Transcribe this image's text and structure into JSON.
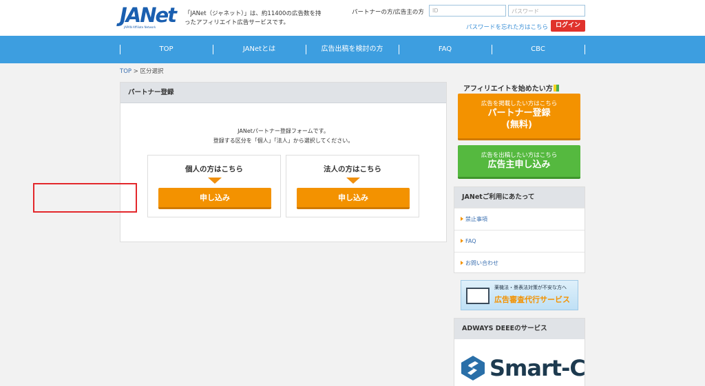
{
  "header": {
    "logo_text": "JANet",
    "logo_sub": "JAPAN Affiliate Network",
    "tagline": "「JANet（ジャネット）」は、約11400の広告数を持ったアフィリエイト広告サービスです。",
    "login_label": "パートナーの方/広告主の方",
    "id_placeholder": "ID",
    "password_placeholder": "パスワード",
    "forgot_password": "パスワードを忘れた方はこちら",
    "login_button": "ログイン"
  },
  "nav": {
    "items": [
      "TOP",
      "JANetとは",
      "広告出稿を検討の方",
      "FAQ",
      "CBC"
    ]
  },
  "breadcrumb": {
    "home": "TOP",
    "separator": ">",
    "current": "区分選択"
  },
  "main": {
    "panel_title": "パートナー登録",
    "intro_line1": "JANetパートナー登録フォームです。",
    "intro_line2": "登録する区分を「個人」「法人」から選択してください。",
    "individual": {
      "title": "個人の方はこちら",
      "button": "申し込み"
    },
    "corporate": {
      "title": "法人の方はこちら",
      "button": "申し込み"
    }
  },
  "sidebar": {
    "title": "アフィリエイトを始めたい方",
    "partner_cta": {
      "sub": "広告を掲載したい方はこちら",
      "main_line1": "パートナー登録",
      "main_line2": "(無料)"
    },
    "advertiser_cta": {
      "sub": "広告を出稿したい方はこちら",
      "main": "広告主申し込み"
    },
    "usage_panel": {
      "title": "JANetご利用にあたって",
      "links": [
        "禁止事項",
        "FAQ",
        "お問い合わせ"
      ]
    },
    "banner": {
      "line1": "薬機法・景表法対策が不安な方へ",
      "line2": "広告審査代行サービス"
    },
    "adways_panel": {
      "title": "ADWAYS DEEEのサービス",
      "smartc_text": "Smart-C"
    }
  },
  "colors": {
    "nav_bg": "#3d9ee0",
    "accent_orange": "#f39200",
    "cta_green": "#55b93f",
    "login_red": "#e0322c",
    "highlight_red": "#e3262a"
  }
}
